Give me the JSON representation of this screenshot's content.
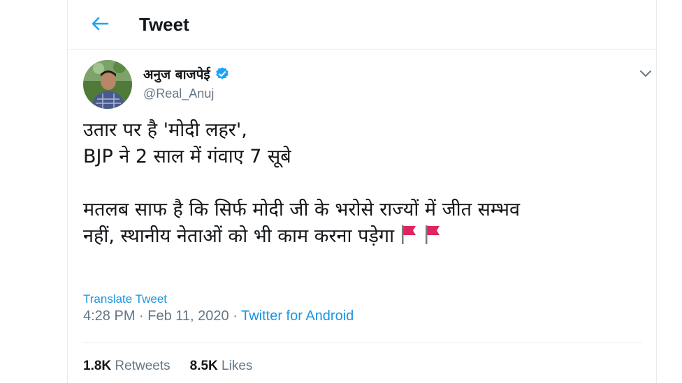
{
  "header": {
    "title": "Tweet",
    "back_icon": "arrow-left-icon"
  },
  "author": {
    "name": "अनुज बाजपेई",
    "handle": "@Real_Anuj",
    "verified_icon": "verified-badge-icon"
  },
  "tweet": {
    "text": "उतार पर है 'मोदी लहर',\nBJP ने 2 साल में गंवाए 7 सूबे\n\nमतलब साफ है कि सिर्फ मोदी जी के भरोसे राज्यों में जीत सम्भव\nनहीं, स्थानीय नेताओं को भी काम करना पड़ेगा",
    "flags": [
      "red-flag-icon",
      "red-flag-icon"
    ],
    "translate_label": "Translate Tweet",
    "time": "4:28 PM",
    "date": "Feb 11, 2020",
    "separator": " · ",
    "source": "Twitter for Android"
  },
  "stats": {
    "retweets_count": "1.8K",
    "retweets_label": "Retweets",
    "likes_count": "8.5K",
    "likes_label": "Likes"
  },
  "colors": {
    "accent": "#1da1f2",
    "link": "#1b95e0",
    "muted": "#657786",
    "flag": "#e0245e"
  }
}
